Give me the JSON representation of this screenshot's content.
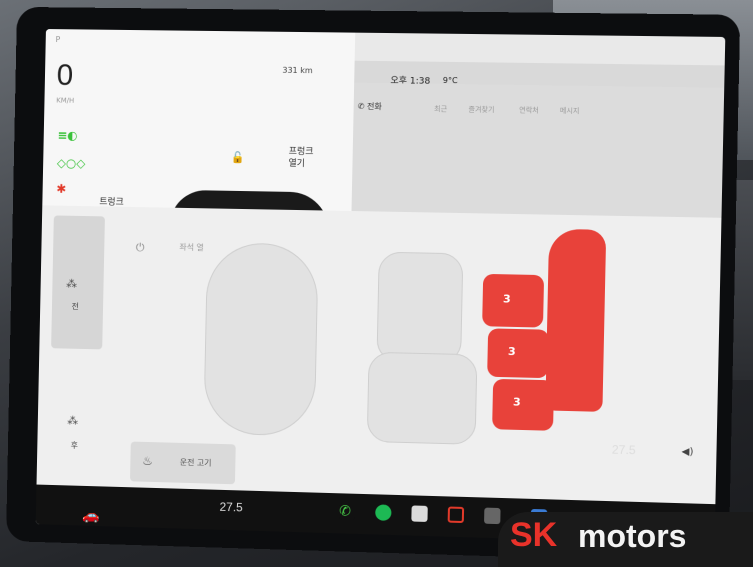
{
  "car_panel": {
    "gear": "P",
    "speed": "0",
    "speed_unit": "KM/H",
    "range": "331 km",
    "indicators": [
      "headlight-icon",
      "parking-light-icon",
      "seatbelt-icon"
    ],
    "trunk_label": "트렁크",
    "trunk_action": "열기",
    "frunk_label": "프렁크",
    "frunk_action": "열기"
  },
  "status_bar": {
    "time": "오후 1:38",
    "outside_temp": "9°C"
  },
  "phone": {
    "title": "전화",
    "tabs": [
      "최근",
      "즐겨찾기",
      "연락처",
      "메시지"
    ]
  },
  "climate": {
    "side_front_label": "전",
    "side_rear_label": "후",
    "auto_label": "좌석 열",
    "steering_heat_label": "운전 고기",
    "seat_heat_levels": [
      "3",
      "3",
      "3"
    ]
  },
  "taskbar": {
    "driver_temp": "27.5",
    "passenger_temp": "27.5",
    "app_icons": [
      "phone-icon",
      "spotify-icon",
      "media-icon",
      "joystick-icon",
      "dashcam-icon",
      "app-icon"
    ]
  },
  "watermark": {
    "brand_red": "SK",
    "brand_white": "motors"
  }
}
